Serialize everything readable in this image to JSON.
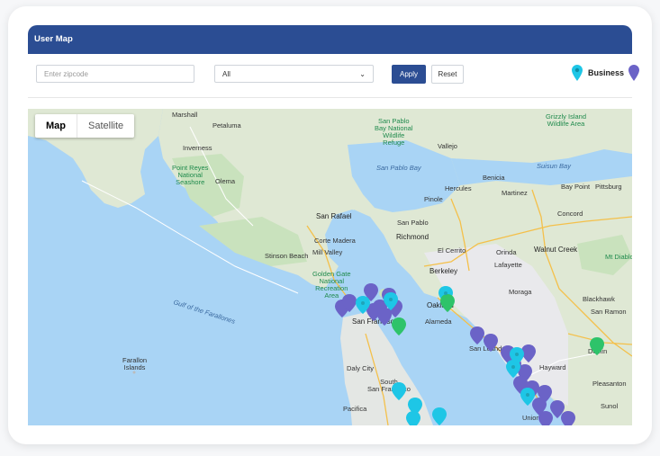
{
  "header": {
    "title": "User Map"
  },
  "filters": {
    "zip_placeholder": "Enter zipcode",
    "category_value": "All",
    "apply_label": "Apply",
    "reset_label": "Reset"
  },
  "legend": {
    "business_label": "Business",
    "business_color": "#1ec6e6",
    "user_color": "#6b63c7"
  },
  "map": {
    "type_buttons": [
      "Map",
      "Satellite"
    ],
    "active_type": "Map",
    "places": [
      {
        "id": "marshall",
        "text": "Marshall",
        "cls": ""
      },
      {
        "id": "petaluma",
        "text": "Petaluma",
        "cls": ""
      },
      {
        "id": "inverness",
        "text": "Inverness",
        "cls": ""
      },
      {
        "id": "pointreyes",
        "text": "Point Reyes\nNational\nSeashore",
        "cls": "g"
      },
      {
        "id": "olema",
        "text": "Olema",
        "cls": ""
      },
      {
        "id": "sanpablobay",
        "text": "San Pablo\nBay National\nWildlife\nRefuge",
        "cls": "g"
      },
      {
        "id": "vallejo",
        "text": "Vallejo",
        "cls": ""
      },
      {
        "id": "grizzly",
        "text": "Grizzly Island\nWildlife Area",
        "cls": "g"
      },
      {
        "id": "sanpablobaywater",
        "text": "San Pablo Bay",
        "cls": "w"
      },
      {
        "id": "benicia",
        "text": "Benicia",
        "cls": ""
      },
      {
        "id": "suisunbay",
        "text": "Suisun Bay",
        "cls": "w"
      },
      {
        "id": "baypoint",
        "text": "Bay Point",
        "cls": ""
      },
      {
        "id": "pittsburg",
        "text": "Pittsburg",
        "cls": ""
      },
      {
        "id": "pinole",
        "text": "Pinole",
        "cls": ""
      },
      {
        "id": "hercules",
        "text": "Hercules",
        "cls": ""
      },
      {
        "id": "martinez",
        "text": "Martinez",
        "cls": ""
      },
      {
        "id": "concord",
        "text": "Concord",
        "cls": ""
      },
      {
        "id": "sanrafael",
        "text": "San Rafael",
        "cls": "b"
      },
      {
        "id": "sanpablo",
        "text": "San Pablo",
        "cls": ""
      },
      {
        "id": "richmond",
        "text": "Richmond",
        "cls": "b"
      },
      {
        "id": "elcerrito",
        "text": "El Cerrito",
        "cls": ""
      },
      {
        "id": "orinda",
        "text": "Orinda",
        "cls": ""
      },
      {
        "id": "walnutcreek",
        "text": "Walnut Creek",
        "cls": "b"
      },
      {
        "id": "cortemadera",
        "text": "Corte Madera",
        "cls": ""
      },
      {
        "id": "millvalley",
        "text": "Mill Valley",
        "cls": ""
      },
      {
        "id": "stinson",
        "text": "Stinson Beach",
        "cls": ""
      },
      {
        "id": "berkeley",
        "text": "Berkeley",
        "cls": "b"
      },
      {
        "id": "lafayette",
        "text": "Lafayette",
        "cls": ""
      },
      {
        "id": "mtdiablo",
        "text": "Mt Diablo",
        "cls": "g"
      },
      {
        "id": "goldengate",
        "text": "Golden Gate\nNational\nRecreation\nArea",
        "cls": "g"
      },
      {
        "id": "oakland",
        "text": "Oakland",
        "cls": "b"
      },
      {
        "id": "alameda",
        "text": "Alameda",
        "cls": ""
      },
      {
        "id": "moraga",
        "text": "Moraga",
        "cls": ""
      },
      {
        "id": "blackhawk",
        "text": "Blackhawk",
        "cls": ""
      },
      {
        "id": "sanramon",
        "text": "San Ramon",
        "cls": ""
      },
      {
        "id": "gulf",
        "text": "Gulf of the Farallones",
        "cls": "w"
      },
      {
        "id": "sanfrancisco",
        "text": "San Francisco",
        "cls": "b"
      },
      {
        "id": "sanleandro",
        "text": "San Leandro",
        "cls": ""
      },
      {
        "id": "dublin",
        "text": "Dublin",
        "cls": ""
      },
      {
        "id": "farallon",
        "text": "Farallon\nIslands",
        "cls": ""
      },
      {
        "id": "dalycity",
        "text": "Daly City",
        "cls": ""
      },
      {
        "id": "hayward",
        "text": "Hayward",
        "cls": ""
      },
      {
        "id": "pleasanton",
        "text": "Pleasanton",
        "cls": ""
      },
      {
        "id": "southsf",
        "text": "South\nSan Francisco",
        "cls": ""
      },
      {
        "id": "sunol",
        "text": "Sunol",
        "cls": ""
      },
      {
        "id": "union",
        "text": "Union",
        "cls": ""
      },
      {
        "id": "pacifica",
        "text": "Pacifica",
        "cls": ""
      }
    ]
  }
}
